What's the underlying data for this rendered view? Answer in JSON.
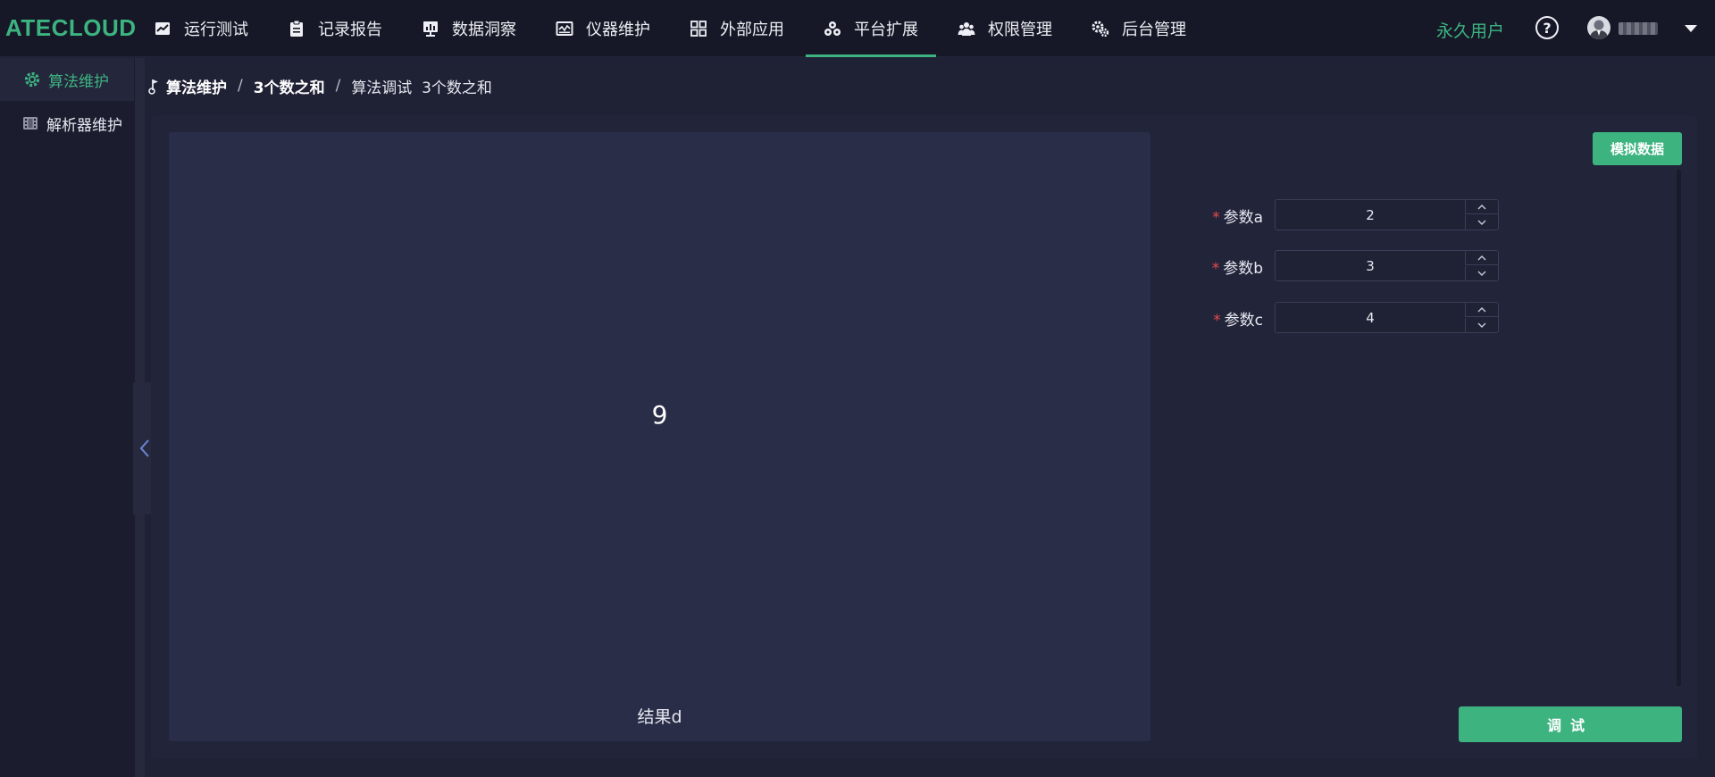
{
  "app": {
    "logo": "ATECLOUD"
  },
  "nav": {
    "items": [
      {
        "label": "运行测试",
        "icon": "chart-line-icon"
      },
      {
        "label": "记录报告",
        "icon": "clipboard-icon"
      },
      {
        "label": "数据洞察",
        "icon": "bar-chart-icon"
      },
      {
        "label": "仪器维护",
        "icon": "instrument-icon"
      },
      {
        "label": "外部应用",
        "icon": "grid-icon"
      },
      {
        "label": "平台扩展",
        "icon": "cubes-icon"
      },
      {
        "label": "权限管理",
        "icon": "users-icon"
      },
      {
        "label": "后台管理",
        "icon": "gears-icon"
      }
    ],
    "active": "平台扩展",
    "perm_user": "永久用户",
    "help": "?"
  },
  "sidebar": {
    "items": [
      {
        "label": "算法维护",
        "icon": "gear-icon",
        "active": true
      },
      {
        "label": "解析器维护",
        "icon": "film-icon",
        "active": false
      }
    ]
  },
  "breadcrumb": {
    "items": [
      "算法维护",
      "3个数之和",
      "算法调试  3个数之和"
    ],
    "separator": "/"
  },
  "result": {
    "value": "9",
    "label": "结果d"
  },
  "toolbar": {
    "mock_label": "模拟数据",
    "debug_label": "调试"
  },
  "params": [
    {
      "label": "参数a",
      "value": "2"
    },
    {
      "label": "参数b",
      "value": "3"
    },
    {
      "label": "参数c",
      "value": "4"
    }
  ],
  "required_mark": "*",
  "colors": {
    "accent": "#3db380",
    "required": "#e84b4b",
    "background": "#1f2135"
  }
}
